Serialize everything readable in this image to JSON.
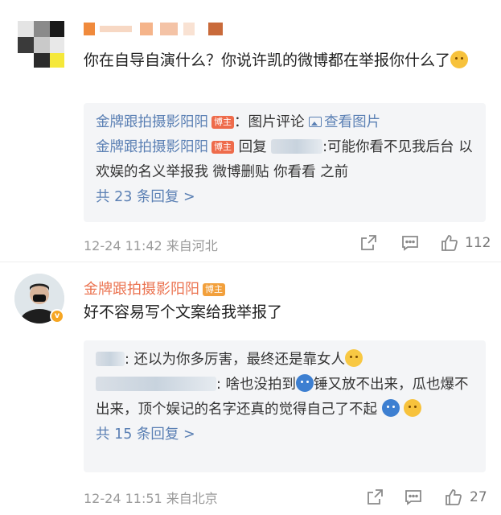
{
  "comments": [
    {
      "name_colors": [
        "#f08a3c",
        "#f5b48a",
        "#f4c3a6",
        "#c96a3a"
      ],
      "text": "你在自导自演什么？你说许凯的微博都在举报你什么了",
      "emoji": "thinking-face",
      "replies": [
        {
          "author": "金牌跟拍摄影阳阳",
          "tag": "博主",
          "body": "：图片评论",
          "link": "查看图片"
        },
        {
          "author": "金牌跟拍摄影阳阳",
          "tag": "博主",
          "reply_word": " 回复",
          "body": ":可能你看不见我后台 以欢娱的名义举报我 微博删贴 你看看 之前"
        }
      ],
      "more_replies": "共 23 条回复 >",
      "time": "12-24 11:42",
      "source": "来自河北",
      "like_count": "112"
    },
    {
      "name": "金牌跟拍摄影阳阳",
      "tag": "博主",
      "text": "好不容易写个文案给我举报了",
      "replies": [
        {
          "body": ": 还以为你多厉害，最终还是靠女人"
        },
        {
          "body": ": 啥也没拍到",
          "body2": "锤又放不出来，瓜也爆不出来，顶个娱记的名字还真的觉得自己了不起"
        }
      ],
      "more_replies": "共 15 条回复 >",
      "time": "12-24 11:51",
      "source": "来自北京",
      "like_count": "27"
    }
  ],
  "icons": [
    "share-icon",
    "comment-icon",
    "like-icon",
    "picture-icon",
    "verified-badge-icon"
  ],
  "colors": {
    "accent_name": "#eb7350",
    "link": "#5b80b4",
    "reply_bg": "#f4f5f7",
    "meta": "#9a9a9a"
  }
}
